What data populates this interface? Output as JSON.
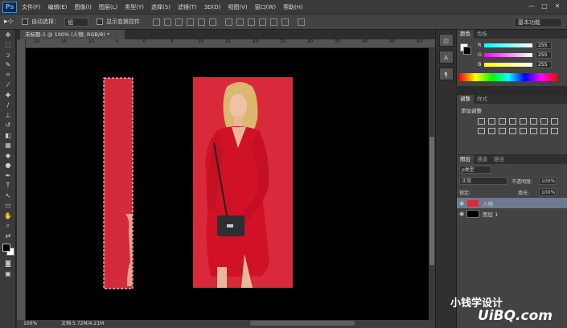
{
  "app": {
    "logo": "Ps"
  },
  "menu": [
    "文件(F)",
    "编辑(E)",
    "图像(I)",
    "图层(L)",
    "类型(Y)",
    "选择(S)",
    "滤镜(T)",
    "3D(D)",
    "视图(V)",
    "窗口(W)",
    "帮助(H)"
  ],
  "options": {
    "auto_select_label": "自动选择：",
    "auto_select_value": "组",
    "show_transform_label": "显示变换控件",
    "workspace": "基本功能"
  },
  "document": {
    "tab_title": "未标题-1 @ 100% (人物, RGB/8) *",
    "zoom": "100%",
    "doc_size": "文档:5.72M/4.21M"
  },
  "ruler_top": [
    "20",
    "15",
    "10",
    "5",
    "0",
    "5",
    "10",
    "15",
    "20",
    "25",
    "30",
    "35",
    "40",
    "45",
    "50"
  ],
  "color_panel": {
    "tabs": [
      "颜色",
      "色板"
    ],
    "channels": [
      {
        "label": "R",
        "value": "255"
      },
      {
        "label": "G",
        "value": "255"
      },
      {
        "label": "B",
        "value": "255"
      }
    ]
  },
  "adjust_panel": {
    "tabs": [
      "调整",
      "样式"
    ],
    "title": "添加调整"
  },
  "layers_panel": {
    "tabs": [
      "图层",
      "通道",
      "路径"
    ],
    "filter": "ρ类型",
    "blend_mode": "正常",
    "opacity_label": "不透明度:",
    "opacity": "100%",
    "lock_label": "锁定:",
    "fill_label": "填充:",
    "fill": "100%",
    "layers": [
      {
        "name": "人物",
        "selected": true
      },
      {
        "name": "图层 1",
        "selected": false
      }
    ]
  },
  "watermark": {
    "text": "小钱学设计",
    "site": "UiBQ.com"
  }
}
